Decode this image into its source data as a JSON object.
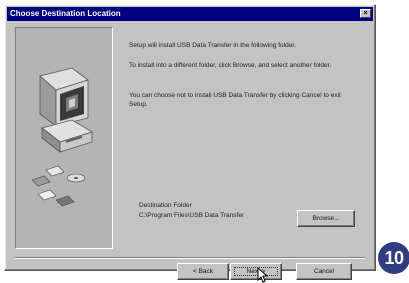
{
  "window": {
    "title": "Choose Destination Location",
    "close_glyph": "×"
  },
  "content": {
    "paragraph1": "Setup will install USB Data Transfer in the following folder.",
    "paragraph2": "To install into a different folder, click Browse, and select another folder.",
    "paragraph3": "You can choose not to install USB Data Transfer by clicking Cancel to exit Setup."
  },
  "destination": {
    "label": "Destination Folder",
    "path": "C:\\Program Files\\USB Data Transfer",
    "browse_label": "Browse..."
  },
  "buttons": {
    "back": "< Back",
    "next": "Next >",
    "cancel": "Cancel"
  },
  "badge": {
    "step_number": "10"
  },
  "colors": {
    "titlebar": "#000080",
    "dialog_face": "#c3c3c3",
    "badge": "#2f3c82"
  },
  "icons": {
    "artwork": "computer-install-illustration",
    "cursor": "arrow-cursor-icon"
  }
}
